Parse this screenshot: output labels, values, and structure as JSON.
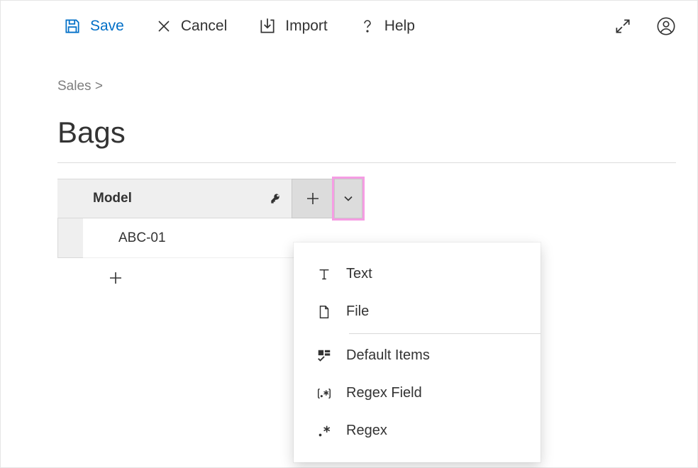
{
  "toolbar": {
    "save_label": "Save",
    "cancel_label": "Cancel",
    "import_label": "Import",
    "help_label": "Help"
  },
  "breadcrumb": {
    "parent": "Sales",
    "separator": ">"
  },
  "page": {
    "title": "Bags"
  },
  "table": {
    "column_header": "Model",
    "rows": [
      {
        "value": "ABC-01"
      }
    ]
  },
  "dropdown_menu": {
    "items": [
      {
        "label": "Text",
        "icon": "text-icon"
      },
      {
        "label": "File",
        "icon": "file-icon"
      },
      {
        "label": "Default Items",
        "icon": "default-items-icon",
        "separator_before": true
      },
      {
        "label": "Regex Field",
        "icon": "regex-field-icon"
      },
      {
        "label": "Regex",
        "icon": "regex-icon"
      }
    ]
  }
}
